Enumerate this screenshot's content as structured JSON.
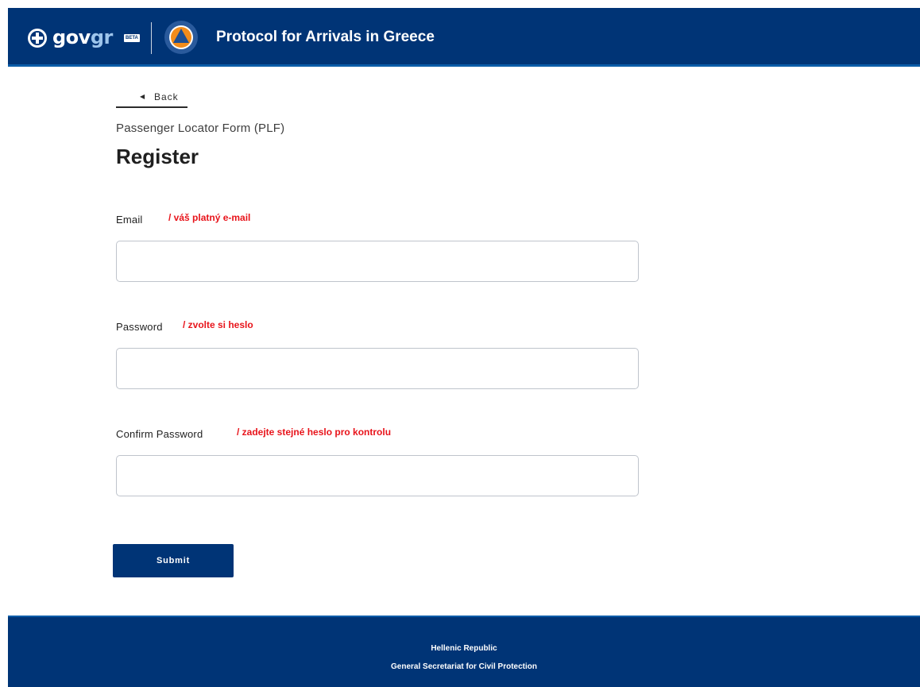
{
  "header": {
    "logo_gov": "gov",
    "logo_gr": "gr",
    "logo_badge": "BETA",
    "title": "Protocol for Arrivals in Greece",
    "emblem_icon": "greek-cross-emblem-icon",
    "civil_protection_icon": "civil-protection-logo-icon"
  },
  "nav": {
    "back_label": "Back",
    "back_icon": "chevron-left-icon"
  },
  "page": {
    "subtitle": "Passenger Locator Form (PLF)",
    "title": "Register"
  },
  "form": {
    "email": {
      "label": "Email",
      "hint": "/ váš platný e-mail",
      "value": "",
      "placeholder": ""
    },
    "password": {
      "label": "Password",
      "hint": "/ zvolte si heslo",
      "value": "",
      "placeholder": ""
    },
    "confirm_password": {
      "label": "Confirm Password",
      "hint": "/ zadejte stejné heslo pro kontrolu",
      "value": "",
      "placeholder": ""
    },
    "submit_label": "Submit"
  },
  "footer": {
    "line1": "Hellenic Republic",
    "line2": "General Secretariat for Civil Protection"
  },
  "colors": {
    "brand_blue": "#003476",
    "accent_blue": "#0b5ca8",
    "hint_red": "#e8141b",
    "civil_protection_orange": "#f28c1b"
  }
}
